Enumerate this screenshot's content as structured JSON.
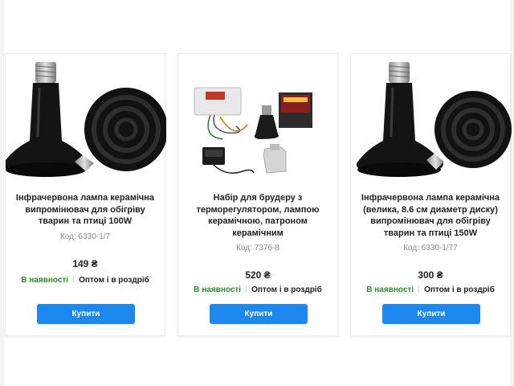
{
  "products": [
    {
      "title": "Інфрачервона лампа керамічна випромінювач для обігріву тварин та птиці 100W",
      "code": "Код: 6330-1/7",
      "price": "149 ₴",
      "stock": "В наявності",
      "sale": "Оптом і в роздріб",
      "buy_label": "Купити",
      "image_icon": "ceramic-heat-lamp-icon"
    },
    {
      "title": "Набір для брудеру з терморегулятором, лампою керамічною, патроном керамічним",
      "code": "Код: 7376-8",
      "price": "520 ₴",
      "stock": "В наявності",
      "sale": "Оптом і в роздріб",
      "buy_label": "Купити",
      "image_icon": "brooder-kit-icon"
    },
    {
      "title": "Інфрачервона лампа керамічна (велика, 8.6 см диаметр диску) випромінювач для обігріву тварин та птиці 150W",
      "code": "Код: 6330-1/77",
      "price": "300 ₴",
      "stock": "В наявності",
      "sale": "Оптом і в роздріб",
      "buy_label": "Купити",
      "image_icon": "ceramic-heat-lamp-icon"
    }
  ],
  "colors": {
    "button": "#1e88ef",
    "in_stock": "#2c8a2c"
  }
}
